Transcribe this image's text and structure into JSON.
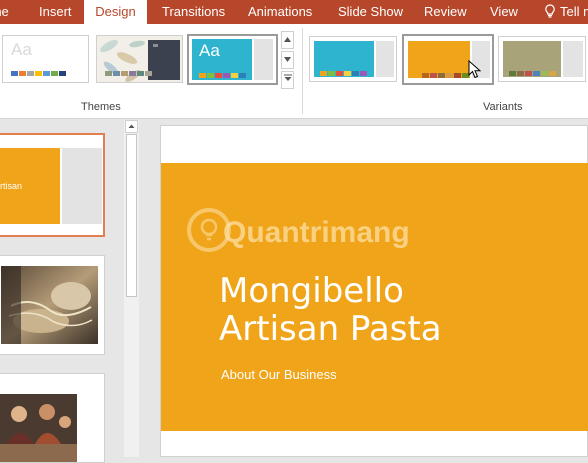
{
  "ribbon": {
    "tabs": [
      {
        "label": "rne"
      },
      {
        "label": "Insert"
      },
      {
        "label": "Design"
      },
      {
        "label": "Transitions"
      },
      {
        "label": "Animations"
      },
      {
        "label": "Slide Show"
      },
      {
        "label": "Review"
      },
      {
        "label": "View"
      },
      {
        "label": "Tell m"
      }
    ],
    "active_tab": "Design",
    "tell_me_icon": "lightbulb-icon",
    "groups": {
      "themes_label": "Themes",
      "variants_label": "Variants"
    },
    "themes": [
      {
        "label": "Aa",
        "accent": "#ffffff",
        "text_color": "#d9d9d9"
      },
      {
        "label": "",
        "accent": "#e4e9ef"
      },
      {
        "label": "Aa",
        "accent": "#2fb4d0",
        "text_color": "#ffffff"
      }
    ],
    "variants": [
      {
        "accent": "#2fb4d0"
      },
      {
        "accent": "#f0a419"
      },
      {
        "accent": "#a9a37a"
      }
    ],
    "colors": {
      "tab_bar": "#b7472a",
      "orange": "#f0a419",
      "cyan": "#2fb4d0",
      "olive": "#a9a37a"
    }
  },
  "slides_pane": {
    "thumb1_text": "rtisan"
  },
  "slide": {
    "title": "Mongibello Artisan Pasta",
    "subtitle": "About Our Business",
    "watermark": "Quantrimang"
  }
}
